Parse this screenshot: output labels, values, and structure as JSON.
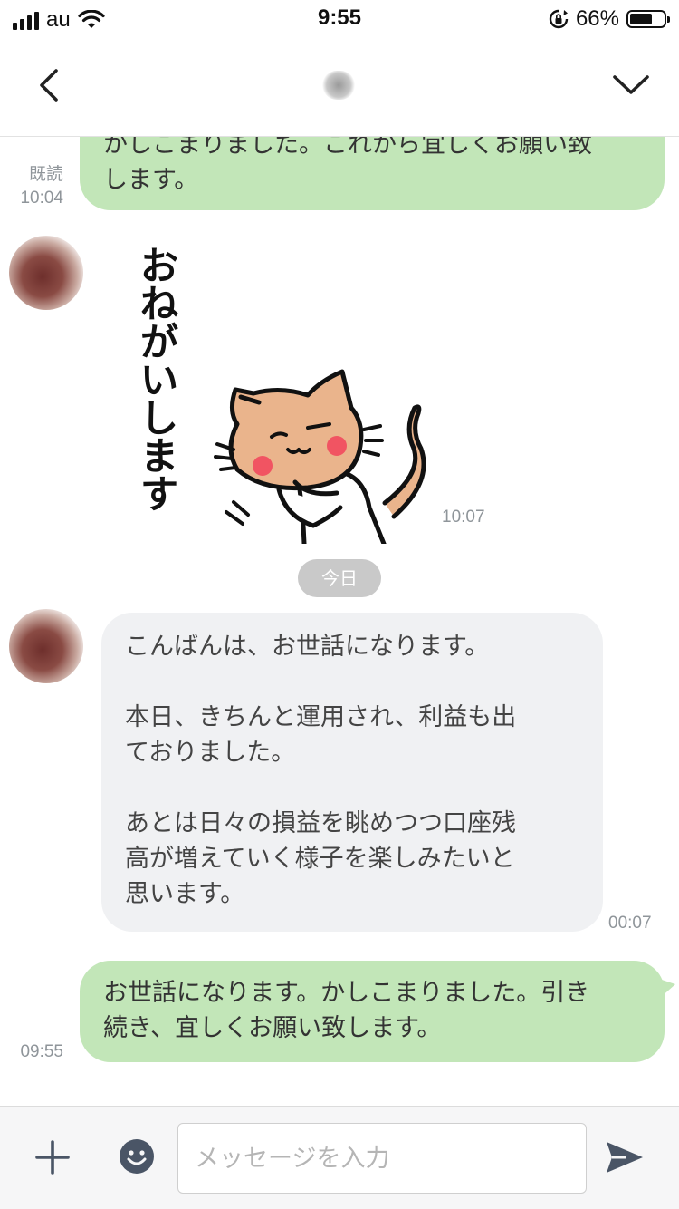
{
  "status_bar": {
    "carrier": "au",
    "time": "9:55",
    "battery_percent": "66%",
    "battery_level": 0.66,
    "icons": [
      "signal-icon",
      "wifi-icon",
      "rotation-lock-icon",
      "battery-icon"
    ]
  },
  "header": {
    "back_icon": "chevron-left-icon",
    "menu_icon": "chevron-down-icon"
  },
  "messages": {
    "m1": {
      "text_line1": "かしこまりました。これから宜しくお願い致",
      "text_line2": "します。",
      "read_label": "既読",
      "time": "10:04"
    },
    "m2": {
      "sticker_text": [
        "お",
        "ね",
        "が",
        "い",
        "し",
        "ま",
        "す"
      ],
      "time": "10:07"
    },
    "date_separator": "今日",
    "m3": {
      "text": "こんばんは、お世話になります。\n\n本日、きちんと運用され、利益も出\nておりました。\n\nあとは日々の損益を眺めつつ口座残\n高が増えていく様子を楽しみたいと\n思います。",
      "time": "00:07"
    },
    "m4": {
      "text_line1": "お世話になります。かしこまりました。引き",
      "text_line2": "続き、宜しくお願い致します。",
      "time": "09:55"
    }
  },
  "input_bar": {
    "placeholder": "メッセージを入力",
    "value": "",
    "icons": [
      "plus-icon",
      "emoji-icon",
      "send-icon"
    ]
  },
  "colors": {
    "my_bubble": "#c2e6b8",
    "their_bubble": "#f0f1f3",
    "date_pill": "#c9c9c9",
    "meta_text": "#8f959a"
  }
}
